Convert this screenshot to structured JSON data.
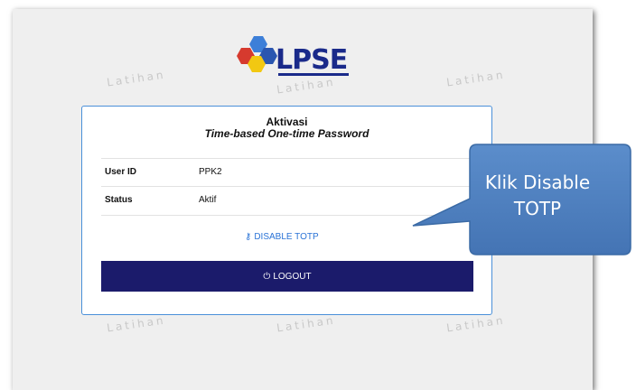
{
  "logo": {
    "text": "LPSE"
  },
  "watermarks": [
    "Latihan",
    "Latihan",
    "Latihan",
    "Latihan",
    "Latihan",
    "Latihan"
  ],
  "card": {
    "title": "Aktivasi",
    "subtitle": "Time-based One-time Password",
    "rows": [
      {
        "label": "User ID",
        "value": "PPK2"
      },
      {
        "label": "Status",
        "value": "Aktif"
      }
    ],
    "disable_link": "DISABLE TOTP",
    "logout_label": "LOGOUT"
  },
  "callout": {
    "line1": "Klik Disable",
    "line2": "TOTP"
  },
  "icons": {
    "disable": "key-icon",
    "logout": "power-icon"
  },
  "colors": {
    "accent": "#2a73d6",
    "logout_bg": "#1b1b6b",
    "callout": "#4f81bd"
  }
}
